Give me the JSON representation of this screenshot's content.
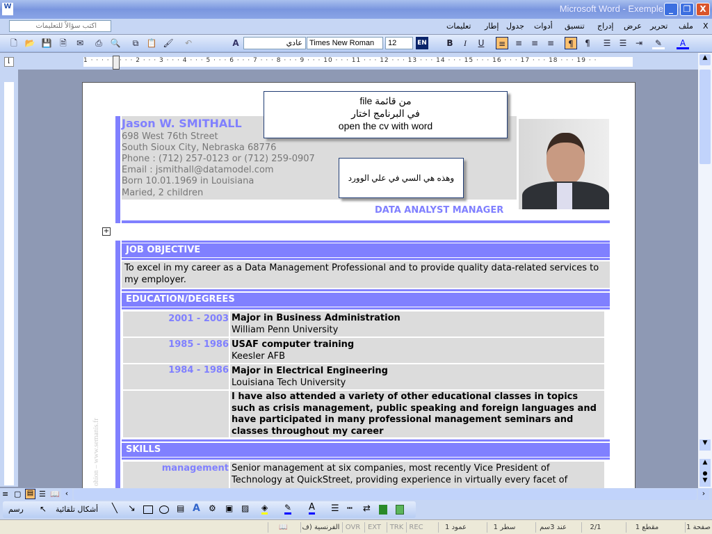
{
  "window": {
    "title": "Microsoft Word - Exemple",
    "minimize": "_",
    "restore": "❐",
    "close": "X"
  },
  "menu": {
    "items": [
      "ملف",
      "تحرير",
      "عرض",
      "إدراج",
      "تنسيق",
      "أدوات",
      "جدول",
      "إطار",
      "تعليمات"
    ],
    "close_doc": "X",
    "ask_placeholder": "اكتب سؤالاً للتعليمات"
  },
  "toolbar": {
    "style": "عادي",
    "font": "Times New Roman",
    "size": "12",
    "lang": "EN",
    "bold": "B",
    "italic": "I",
    "underline": "U"
  },
  "ruler": {
    "ticks": "1 · · · · 1 · · · 2 · · · 3 · · · 4 · · · 5 · · · 6 · · · 7 · · · 8 · · · 9 · · · 10 · · · 11 · · · 12 · · · 13 · · · 14 · · · 15 · · · 16 · · · 17 · · · 18 · · · 19 · ·"
  },
  "colors": {
    "accent": "#8080ff",
    "gray": "#dcdcdc"
  },
  "resume": {
    "name": "Jason W. SMITHALL",
    "contact": [
      "698 West 76th Street",
      "South Sioux City, Nebraska 68776",
      "Phone : (712) 257-0123 or (712) 259-0907",
      "Email : jsmithall@datamodel.com",
      "Born 10.01.1969 in Louisiana",
      "Maried, 2 children"
    ],
    "role": "DATA ANALYST MANAGER",
    "sections": {
      "objective": {
        "title": "JOB OBJECTIVE",
        "text": "To excel in my career as a Data Management Professional and to provide quality data-related services to my employer."
      },
      "education": {
        "title": "EDUCATION/DEGREES",
        "items": [
          {
            "years": "2001 - 2003",
            "degree": "Major in Business Administration",
            "school": "William Penn University"
          },
          {
            "years": "1985 - 1986",
            "degree": "USAF computer training",
            "school": "Keesler AFB"
          },
          {
            "years": "1984 - 1986",
            "degree": "Major in Electrical Engineering",
            "school": "Louisiana Tech University"
          }
        ],
        "note": "I have also attended a variety of other educational classes in topics such as crisis management, public speaking and foreign languages and have participated in many professional management seminars and classes throughout my career"
      },
      "skills": {
        "title": "SKILLS",
        "items": [
          {
            "label": "management",
            "text": "Senior management at six companies, most recently Vice President of Technology at QuickStreet, providing experience in virtually every facet of"
          }
        ]
      }
    },
    "watermark": "ohion – www.semanis.fr"
  },
  "callouts": {
    "first": [
      "file من قائمة",
      "في البرنامج اختار",
      "open the cv with word"
    ],
    "second": "وهذه هي السي في علي الوورد"
  },
  "drawing": {
    "draw": "رسم",
    "autoshapes": "أشكال تلقائية"
  },
  "status": {
    "page": "صفحة 1",
    "section": "مقطع 1",
    "pages": "2/1",
    "at": "عند 3سم",
    "line": "سطر 1",
    "col": "عمود 1",
    "rec": "REC",
    "trk": "TRK",
    "ext": "EXT",
    "ovr": "OVR",
    "lang": "الفرنسية (ف"
  }
}
